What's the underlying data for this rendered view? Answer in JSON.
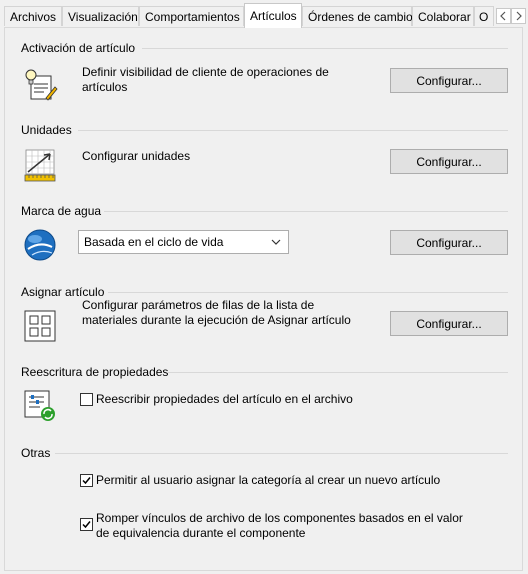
{
  "tabs": [
    {
      "label": "Archivos",
      "active": false
    },
    {
      "label": "Visualización",
      "active": false
    },
    {
      "label": "Comportamientos",
      "active": false
    },
    {
      "label": "Artículos",
      "active": true
    },
    {
      "label": "Órdenes de cambio",
      "active": false
    },
    {
      "label": "Colaborar",
      "active": false
    },
    {
      "label": "O",
      "active": false
    }
  ],
  "sections": {
    "activacion": {
      "title": "Activación de artículo",
      "description": "Definir visibilidad de cliente de operaciones de artículos",
      "button": "Configurar...",
      "icon": "lightbulb-document-icon"
    },
    "unidades": {
      "title": "Unidades",
      "description": "Configurar unidades",
      "button": "Configurar...",
      "icon": "units-ruler-icon"
    },
    "marca_agua": {
      "title": "Marca de agua",
      "select_value": "Basada en el ciclo de vida",
      "button": "Configurar...",
      "icon": "globe-icon"
    },
    "asignar": {
      "title": "Asignar artículo",
      "description": "Configurar parámetros de filas de la lista de materiales durante la ejecución de Asignar artículo",
      "button": "Configurar...",
      "icon": "grid-assign-icon"
    },
    "reescritura": {
      "title": "Reescritura de propiedades",
      "checkbox_label": "Reescribir propiedades del artículo en el archivo",
      "checked": false,
      "icon": "property-writeback-icon"
    },
    "otras": {
      "title": "Otras",
      "option1_label": "Permitir al usuario asignar la categoría al crear un nuevo artículo",
      "option1_checked": true,
      "option2_label": "Romper vínculos de archivo de los componentes basados en el valor de equivalencia durante el componente",
      "option2_checked": true
    }
  },
  "colors": {
    "accent": "#1e6fc0",
    "panel_bg": "#f0f0f0",
    "button_bg": "#e1e1e1",
    "divider": "#d8d8d8"
  }
}
